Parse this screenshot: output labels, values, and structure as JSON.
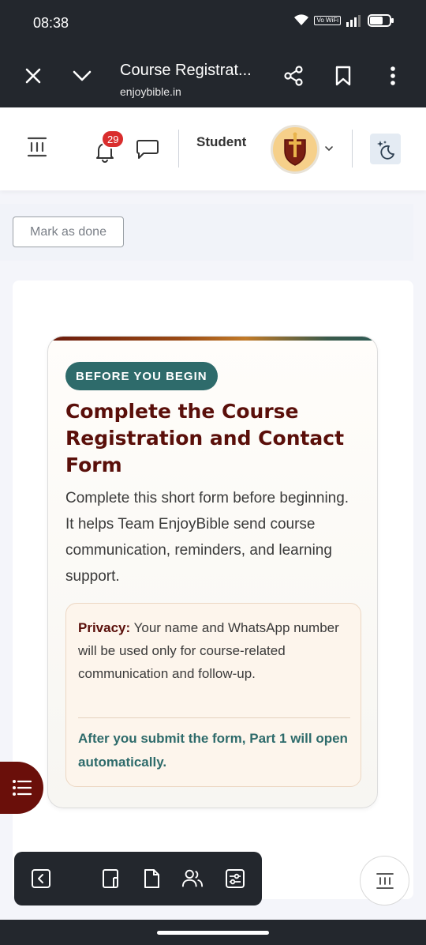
{
  "status_bar": {
    "time": "08:38",
    "vowifi_label": "Vo WiFi",
    "icons": [
      "wifi-icon",
      "signal-icon",
      "battery-icon"
    ]
  },
  "browser": {
    "title": "Course Registrat...",
    "url": "enjoybible.in",
    "icons": [
      "close-icon",
      "chevron-down-icon",
      "share-icon",
      "bookmark-icon",
      "more-vertical-icon"
    ]
  },
  "site_header": {
    "notification_count": "29",
    "role_label": "Student",
    "icons": [
      "menu-icon",
      "bell-icon",
      "chat-icon",
      "avatar-shield-icon",
      "chevron-down-icon",
      "moon-stars-icon"
    ]
  },
  "actions": {
    "mark_done_label": "Mark as done"
  },
  "card": {
    "tag": "BEFORE YOU BEGIN",
    "title": "Complete the Course Registration and Contact Form",
    "description": "Complete this short form before beginning. It helps Team EnjoyBible send course communication, reminders, and learning support.",
    "privacy_label": "Privacy:",
    "privacy_text": " Your name and WhatsApp number will be used only for course-related communication and follow-up.",
    "note": "After you submit the form, Part 1 will open automatically."
  },
  "toolbar": {
    "icons": [
      "back-arrow-icon",
      "notebook-icon",
      "document-icon",
      "users-icon",
      "settings-sliders-icon"
    ]
  },
  "colors": {
    "dark_bar": "#23272d",
    "brand_maroon": "#5a0f0a",
    "teal": "#2e6b6b",
    "badge_red": "#d92d2d",
    "privacy_bg": "#fdf5ec"
  }
}
